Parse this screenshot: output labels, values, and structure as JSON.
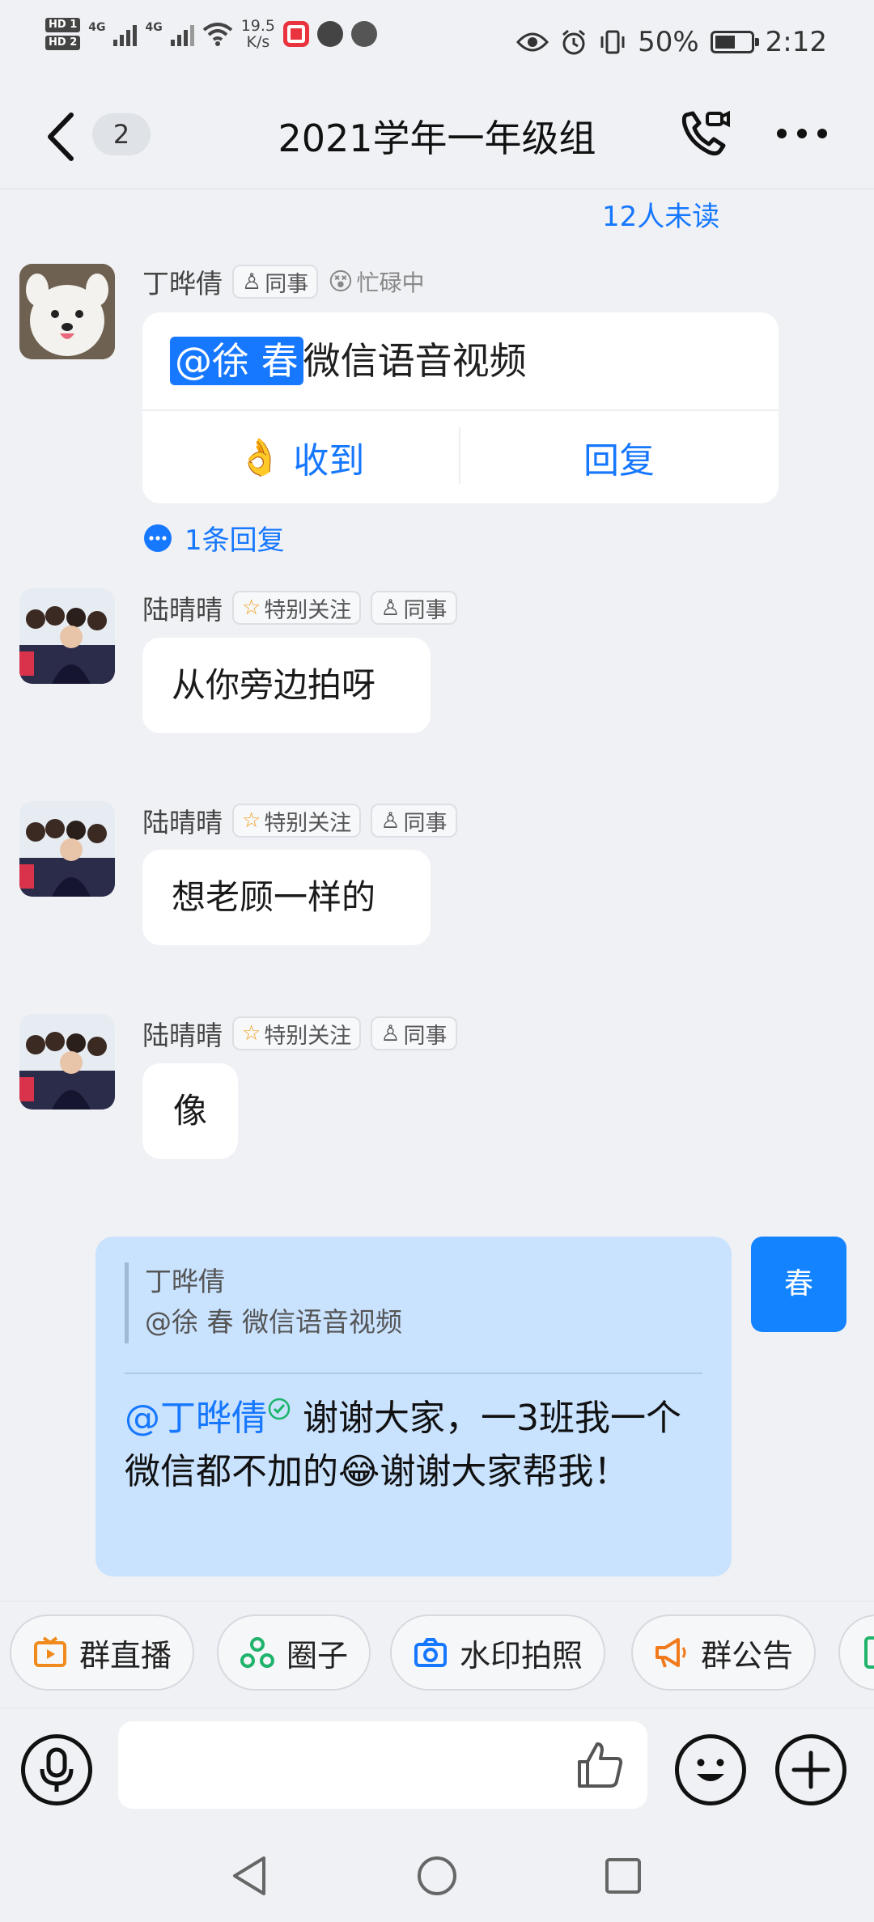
{
  "status_bar": {
    "sim1": "HD 1",
    "sim2": "HD 2",
    "net1": "4G",
    "net2": "4G",
    "speed_value": "19.5",
    "speed_unit": "K/s",
    "battery": "50%",
    "time": "2:12"
  },
  "header": {
    "unread_badge": "2",
    "title": "2021学年一年级组"
  },
  "messages": {
    "top_unread": "12人未读",
    "m1": {
      "sender": "丁晔倩",
      "tag": "同事",
      "status": "忙碌中",
      "mention": "@徐  春",
      "text": "微信语音视频",
      "action_received": "收到",
      "action_reply": "回复",
      "reply_count": "1条回复"
    },
    "m2": {
      "sender": "陆晴晴",
      "tag_follow": "特别关注",
      "tag_colleague": "同事",
      "text": "从你旁边拍呀"
    },
    "m3": {
      "sender": "陆晴晴",
      "tag_follow": "特别关注",
      "tag_colleague": "同事",
      "text": "想老顾一样的"
    },
    "m4": {
      "sender": "陆晴晴",
      "tag_follow": "特别关注",
      "tag_colleague": "同事",
      "text": "像"
    },
    "mine": {
      "quote_name": "丁晔倩",
      "quote_text": "@徐  春 微信语音视频",
      "at": "@丁晔倩",
      "text_part1": " 谢谢大家，一3班我一个微信都不加的",
      "emoji": "😂",
      "text_part2": "谢谢大家帮我！",
      "avatar_text": "春"
    }
  },
  "quick_actions": [
    {
      "label": "群直播",
      "icon": "live-icon"
    },
    {
      "label": "圈子",
      "icon": "circle-icon"
    },
    {
      "label": "水印拍照",
      "icon": "camera-icon"
    },
    {
      "label": "群公告",
      "icon": "megaphone-icon"
    }
  ],
  "colors": {
    "accent": "#1677ff",
    "my_bubble": "#c9e2fe",
    "background": "#eff1f4"
  }
}
